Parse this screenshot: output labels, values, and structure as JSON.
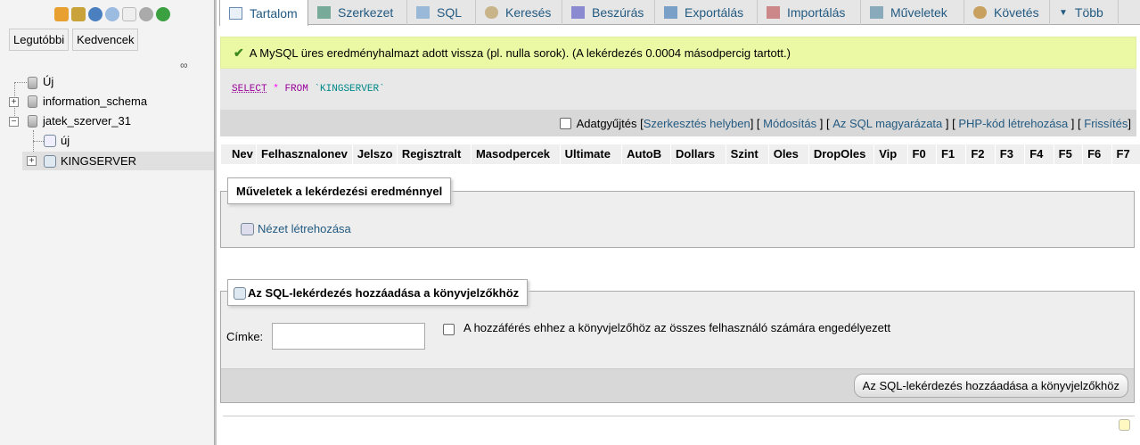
{
  "sidebar": {
    "tabs": [
      "Legutóbbi",
      "Kedvencek"
    ],
    "tree": {
      "new": "Új",
      "db1": "information_schema",
      "db2": "jatek_szerver_31",
      "sub_new": "új",
      "table": "KINGSERVER"
    }
  },
  "tabs": [
    "Tartalom",
    "Szerkezet",
    "SQL",
    "Keresés",
    "Beszúrás",
    "Exportálás",
    "Importálás",
    "Műveletek",
    "Követés",
    "Több"
  ],
  "success": "A MySQL üres eredményhalmazt adott vissza (pl. nulla sorok). (A lekérdezés 0.0004 másodpercig tartott.)",
  "sql": {
    "select": "SELECT",
    "star": "*",
    "from": "FROM",
    "table": "`KINGSERVER`"
  },
  "actions": {
    "profiling": "Adatgyűjtés",
    "edit_inline": "Szerkesztés helyben",
    "edit": "Módosítás",
    "explain": "Az SQL magyarázata",
    "php": "PHP-kód létrehozása",
    "refresh": "Frissítés"
  },
  "columns": [
    "Nev",
    "Felhasznalonev",
    "Jelszo",
    "Regisztralt",
    "Masodpercek",
    "Ultimate",
    "AutoB",
    "Dollars",
    "Szint",
    "Oles",
    "DropOles",
    "Vip",
    "F0",
    "F1",
    "F2",
    "F3",
    "F4",
    "F5",
    "F6",
    "F7"
  ],
  "ops": {
    "legend": "Műveletek a lekérdezési eredménnyel",
    "create_view": "Nézet létrehozása"
  },
  "bookmark": {
    "legend": "Az SQL-lekérdezés hozzáadása a könyvjelzőkhöz",
    "label": "Címke:",
    "label_value": "",
    "shared": "A hozzáférés ehhez a könyvjelzőhöz az összes felhasználó számára engedélyezett",
    "submit": "Az SQL-lekérdezés hozzáadása a könyvjelzőkhöz"
  }
}
